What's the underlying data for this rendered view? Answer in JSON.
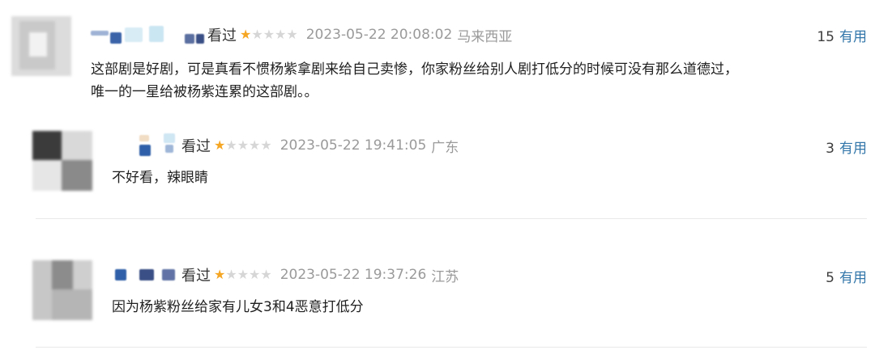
{
  "comments": [
    {
      "status": "看过",
      "rating": 1,
      "rating_max": 5,
      "time": "2023-05-22 20:08:02",
      "location": "马来西亚",
      "votes": "15",
      "vote_label": "有用",
      "content_lines": [
        "这部剧是好剧，可是真看不惯杨紫拿剧来给自己卖惨，你家粉丝给别人剧打低分的时候可没有那么道德过，",
        "唯一的一星给被杨紫连累的这部剧。。"
      ]
    },
    {
      "status": "看过",
      "rating": 1,
      "rating_max": 5,
      "time": "2023-05-22 19:41:05",
      "location": "广东",
      "votes": "3",
      "vote_label": "有用",
      "content_lines": [
        "不好看，辣眼睛"
      ]
    },
    {
      "status": "看过",
      "rating": 1,
      "rating_max": 5,
      "time": "2023-05-22 19:37:26",
      "location": "江苏",
      "votes": "5",
      "vote_label": "有用",
      "content_lines": [
        "因为杨紫粉丝给家有儿女3和4恶意打低分"
      ]
    }
  ],
  "colors": {
    "star_on": "#f5a623",
    "star_off": "#d6d6d6",
    "vote_link": "#3377aa",
    "meta_text": "#9a9a9a"
  },
  "icons": {
    "star": "star-icon"
  }
}
